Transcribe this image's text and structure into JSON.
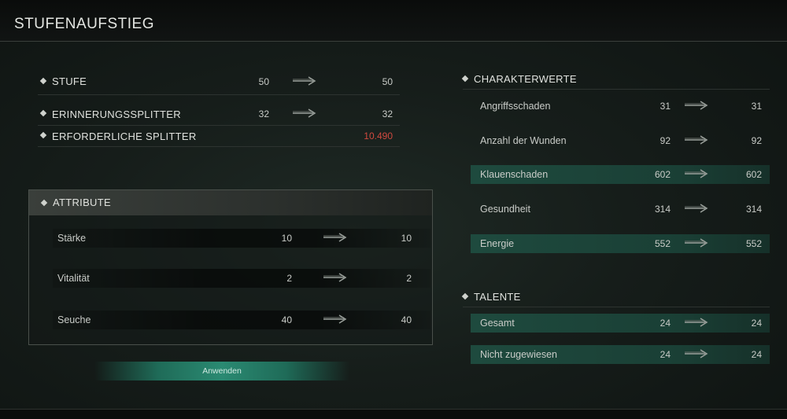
{
  "title": "STUFENAUFSTIEG",
  "level": {
    "rows": [
      {
        "label": "STUFE",
        "from": "50",
        "to": "50"
      },
      {
        "label": "ERINNERUNGSSPLITTER",
        "from": "32",
        "to": "32"
      },
      {
        "label": "ERFORDERLICHE SPLITTER",
        "from": "",
        "to": "10.490"
      }
    ]
  },
  "attributes": {
    "header": "ATTRIBUTE",
    "rows": [
      {
        "label": "Stärke",
        "from": "10",
        "to": "10"
      },
      {
        "label": "Vitalität",
        "from": "2",
        "to": "2"
      },
      {
        "label": "Seuche",
        "from": "40",
        "to": "40"
      }
    ]
  },
  "apply_label": "Anwenden",
  "charakterwerte": {
    "header": "CHARAKTERWERTE",
    "rows": [
      {
        "label": "Angriffsschaden",
        "from": "31",
        "to": "31",
        "highlight": false
      },
      {
        "label": "Anzahl der Wunden",
        "from": "92",
        "to": "92",
        "highlight": false
      },
      {
        "label": "Klauenschaden",
        "from": "602",
        "to": "602",
        "highlight": true
      },
      {
        "label": "Gesundheit",
        "from": "314",
        "to": "314",
        "highlight": false
      },
      {
        "label": "Energie",
        "from": "552",
        "to": "552",
        "highlight": true
      }
    ]
  },
  "talente": {
    "header": "TALENTE",
    "rows": [
      {
        "label": "Gesamt",
        "from": "24",
        "to": "24",
        "highlight": true
      },
      {
        "label": "Nicht zugewiesen",
        "from": "24",
        "to": "24",
        "highlight": true
      }
    ]
  },
  "colors": {
    "accent": "#2a8a72",
    "warning": "#d0493f"
  },
  "icons": {
    "bullet": "diamond-icon",
    "arrow": "arrow-right-icon"
  }
}
